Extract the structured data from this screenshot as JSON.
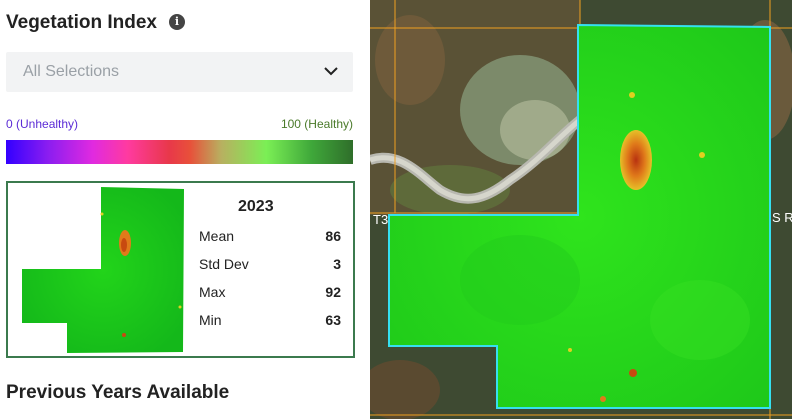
{
  "panel": {
    "title": "Vegetation Index",
    "info_icon": "info-icon",
    "dropdown": {
      "placeholder": "All Selections",
      "icon": "chevron-down-icon"
    },
    "legend": {
      "low_label": "0 (Unhealthy)",
      "high_label": "100 (Healthy)",
      "low_color": "#5b2bd6",
      "high_color": "#4a7a2a"
    },
    "card": {
      "year": "2023",
      "stats": [
        {
          "label": "Mean",
          "value": "86"
        },
        {
          "label": "Std Dev",
          "value": "3"
        },
        {
          "label": "Max",
          "value": "92"
        },
        {
          "label": "Min",
          "value": "63"
        }
      ],
      "border_color": "#3b7a4e"
    },
    "previous_heading": "Previous Years Available"
  },
  "map": {
    "labels": [
      "T3",
      "S R"
    ],
    "boundary_color": "#35e0f0",
    "grid_color": "#f0a020"
  }
}
